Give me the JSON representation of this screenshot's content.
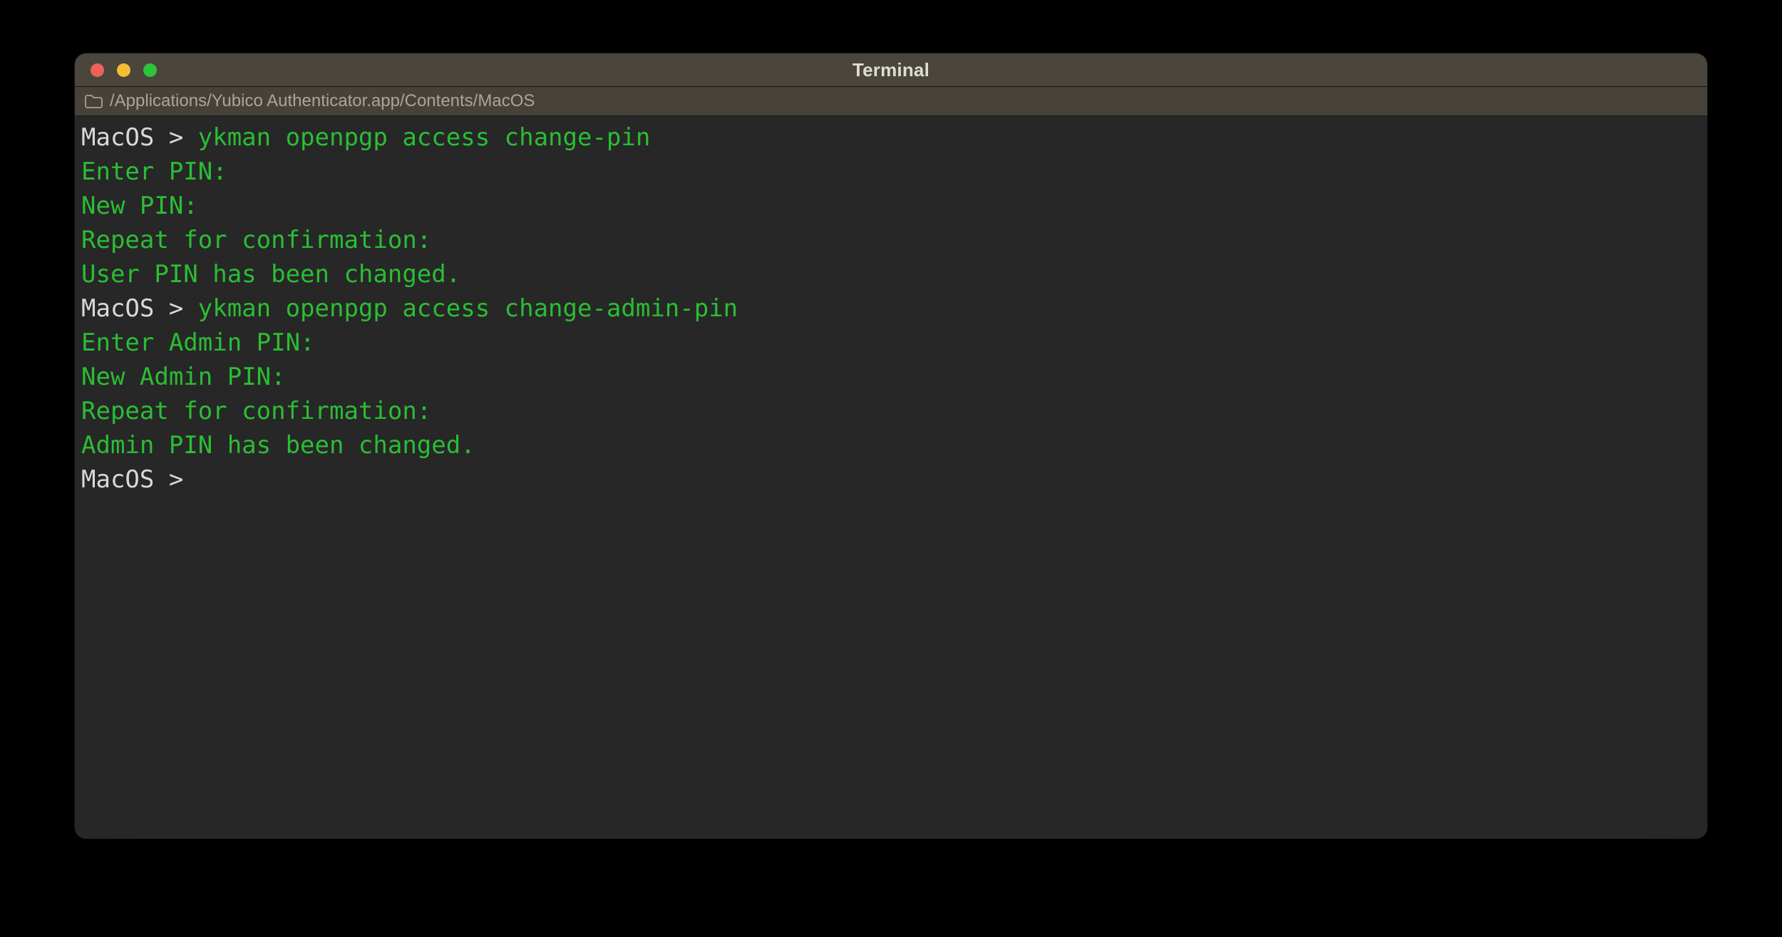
{
  "window": {
    "title": "Terminal",
    "controls": [
      {
        "name": "close-button",
        "color": "#ef6158"
      },
      {
        "name": "minimize-button",
        "color": "#f5bd35"
      },
      {
        "name": "zoom-button",
        "color": "#2dc53e"
      }
    ]
  },
  "pathbar": {
    "icon": "folder-icon",
    "path": "/Applications/Yubico Authenticator.app/Contents/MacOS"
  },
  "colors": {
    "desktop_bg": "#000000",
    "titlebar_bg": "#4a463c",
    "pathbar_bg": "#46423a",
    "terminal_bg": "#272727",
    "prompt_fg": "#d9d9d9",
    "green_fg": "#2abe33",
    "title_fg": "#dfdcd6",
    "path_fg": "#a9a59d"
  },
  "terminal": {
    "lines": [
      {
        "segments": [
          {
            "text": "MacOS > ",
            "color": "fg"
          },
          {
            "text": "ykman openpgp access change-pin",
            "color": "green"
          }
        ]
      },
      {
        "segments": [
          {
            "text": "Enter PIN:",
            "color": "green"
          }
        ]
      },
      {
        "segments": [
          {
            "text": "New PIN:",
            "color": "green"
          }
        ]
      },
      {
        "segments": [
          {
            "text": "Repeat for confirmation:",
            "color": "green"
          }
        ]
      },
      {
        "segments": [
          {
            "text": "User PIN has been changed.",
            "color": "green"
          }
        ]
      },
      {
        "segments": [
          {
            "text": "MacOS > ",
            "color": "fg"
          },
          {
            "text": "ykman openpgp access change-admin-pin",
            "color": "green"
          }
        ]
      },
      {
        "segments": [
          {
            "text": "Enter Admin PIN:",
            "color": "green"
          }
        ]
      },
      {
        "segments": [
          {
            "text": "New Admin PIN:",
            "color": "green"
          }
        ]
      },
      {
        "segments": [
          {
            "text": "Repeat for confirmation:",
            "color": "green"
          }
        ]
      },
      {
        "segments": [
          {
            "text": "Admin PIN has been changed.",
            "color": "green"
          }
        ]
      },
      {
        "segments": [
          {
            "text": "MacOS > ",
            "color": "fg"
          }
        ]
      }
    ]
  }
}
